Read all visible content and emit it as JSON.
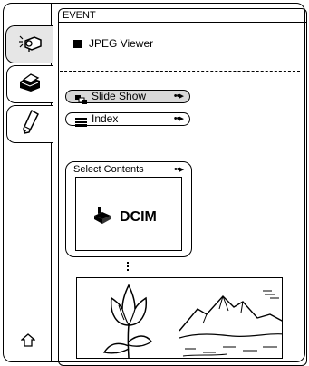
{
  "header": {
    "title": "EVENT"
  },
  "viewer": {
    "label": "JPEG Viewer"
  },
  "menu": {
    "slide_show": {
      "label": "Slide Show",
      "arrow": "••▸"
    },
    "index": {
      "label": "Index",
      "arrow": "••▸"
    }
  },
  "select_contents": {
    "title": "Select Contents",
    "arrow": "••▸",
    "folder_label": "DCIM"
  },
  "sidebar": {
    "tabs": [
      {
        "icon": "camera-icon",
        "active": true
      },
      {
        "icon": "printer-icon",
        "active": false
      },
      {
        "icon": "pen-icon",
        "active": false
      }
    ],
    "home_icon": "home-icon"
  },
  "thumbnails": [
    {
      "icon": "tulip-image"
    },
    {
      "icon": "mountain-landscape-image"
    }
  ]
}
